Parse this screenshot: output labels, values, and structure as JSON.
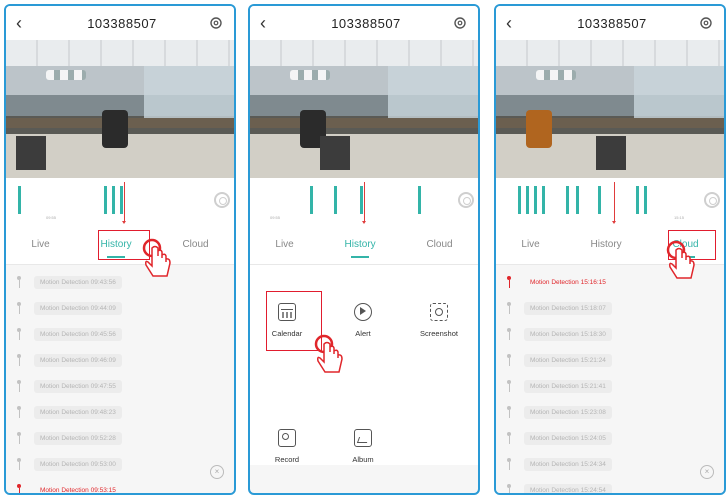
{
  "phones": [
    {
      "title": "103388507",
      "tabs": [
        "Live",
        "History",
        "Cloud"
      ],
      "active_tab": "History",
      "timeline_time": "09:55",
      "events": [
        {
          "label": "Motion Detection",
          "time": "09:43:56",
          "highlight": false
        },
        {
          "label": "Motion Detection",
          "time": "09:44:09",
          "highlight": false
        },
        {
          "label": "Motion Detection",
          "time": "09:45:56",
          "highlight": false
        },
        {
          "label": "Motion Detection",
          "time": "09:46:09",
          "highlight": false
        },
        {
          "label": "Motion Detection",
          "time": "09:47:55",
          "highlight": false
        },
        {
          "label": "Motion Detection",
          "time": "09:48:23",
          "highlight": false
        },
        {
          "label": "Motion Detection",
          "time": "09:52:28",
          "highlight": false
        },
        {
          "label": "Motion Detection",
          "time": "09:53:00",
          "highlight": false
        },
        {
          "label": "Motion Detection",
          "time": "09:53:15",
          "highlight": true
        }
      ]
    },
    {
      "title": "103388507",
      "tabs": [
        "Live",
        "History",
        "Cloud"
      ],
      "active_tab": "History",
      "timeline_time": "09:55",
      "menu": [
        "Calendar",
        "Alert",
        "Screenshot",
        "Record",
        "Album"
      ]
    },
    {
      "title": "103388507",
      "tabs": [
        "Live",
        "History",
        "Cloud"
      ],
      "active_tab": "Cloud",
      "timeline_time": "15:15",
      "events": [
        {
          "label": "Motion Detection",
          "time": "15:16:15",
          "highlight": true
        },
        {
          "label": "Motion Detection",
          "time": "15:18:07",
          "highlight": false
        },
        {
          "label": "Motion Detection",
          "time": "15:18:30",
          "highlight": false
        },
        {
          "label": "Motion Detection",
          "time": "15:21:24",
          "highlight": false
        },
        {
          "label": "Motion Detection",
          "time": "15:21:41",
          "highlight": false
        },
        {
          "label": "Motion Detection",
          "time": "15:23:08",
          "highlight": false
        },
        {
          "label": "Motion Detection",
          "time": "15:24:05",
          "highlight": false
        },
        {
          "label": "Motion Detection",
          "time": "15:24:34",
          "highlight": false
        },
        {
          "label": "Motion Detection",
          "time": "15:24:54",
          "highlight": false
        }
      ]
    }
  ],
  "colors": {
    "frame": "#2a9ad6",
    "accent": "#33b4a8",
    "highlight": "#e11d2e"
  },
  "icons": {
    "back": "chevron-left-icon",
    "settings": "gear-icon",
    "tap": "hand-pointer-icon"
  }
}
